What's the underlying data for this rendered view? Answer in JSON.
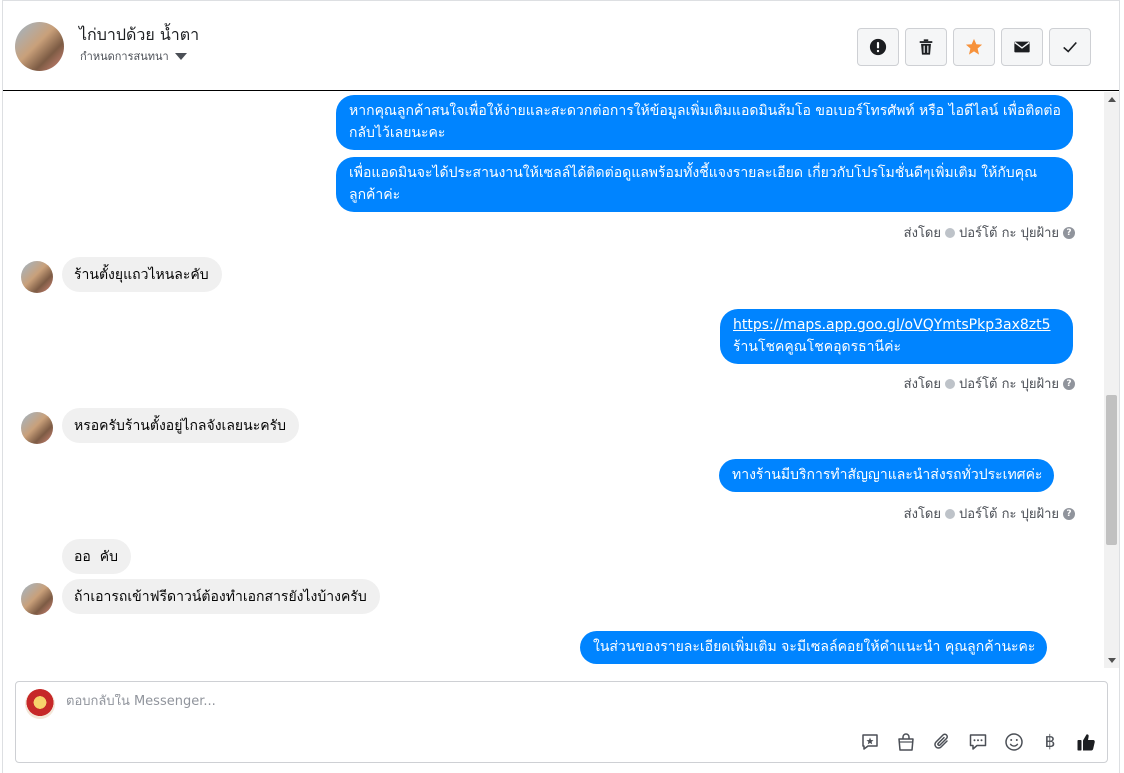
{
  "header": {
    "contact_name": "ไก่บาปด้วย น้ำตา",
    "assign_label": "กำหนดการสนทนา",
    "actions": [
      {
        "name": "mark-spam-button",
        "icon": "exclamation-circle-icon"
      },
      {
        "name": "delete-button",
        "icon": "trash-icon"
      },
      {
        "name": "star-button",
        "icon": "star-icon"
      },
      {
        "name": "mark-unread-button",
        "icon": "envelope-icon"
      },
      {
        "name": "mark-done-button",
        "icon": "check-icon"
      }
    ]
  },
  "messages": {
    "m1": "หากคุณลูกค้าสนใจเพื่อให้ง่ายและสะดวกต่อการให้ข้อมูลเพิ่มเติมแอดมินส้มโอ ขอเบอร์โทรศัพท์ หรือ ไอดีไลน์ เพื่อติดต่อกลับไว้เลยนะคะ",
    "m2": "เพื่อแอดมินจะได้ประสานงานให้เซลล์ได้ติดต่อดูแลพร้อมทั้งชี้แจงรายละเอียด เกี่ยวกับโปรโมชั่นดีๆเพิ่มเติม ให้กับคุณลูกค้าค่ะ",
    "m3": "ร้านตั้งยุแถวไหนละคับ",
    "m4_link": "https://maps.app.goo.gl/oVQYmtsPkp3ax8zt5",
    "m4_text": "ร้านโชคคูณโชคอุดรธานีค่ะ",
    "m5": "หรอครับร้านตั้งอยู่ไกลจังเลยนะครับ",
    "m6": "ทางร้านมีบริการทำสัญญาและนำส่งรถทั่วประเทศค่ะ",
    "m7": "ออ  คับ",
    "m8": "ถ้าเอารถเข้าฟรีดาวน์ต้องทำเอกสารยังไงบ้างครับ",
    "m9": "ในส่วนของรายละเอียดเพิ่มเติม จะมีเซลล์คอยให้คำแนะนำ คุณลูกค้านะคะ"
  },
  "sent_by": {
    "prefix": "ส่งโดย",
    "name": "ปอร์โต้ กะ ปุยฝ้าย"
  },
  "composer": {
    "placeholder": "ตอบกลับใน Messenger...",
    "currency_symbol": "฿",
    "tools": [
      "saved-reply-icon",
      "shop-bag-icon",
      "paperclip-icon",
      "chat-bubble-icon",
      "smiley-icon",
      "baht-icon",
      "thumbs-up-icon"
    ]
  },
  "colors": {
    "outgoing_bubble": "#0084ff",
    "incoming_bubble": "#f0f0f0",
    "star": "#f7923b"
  }
}
